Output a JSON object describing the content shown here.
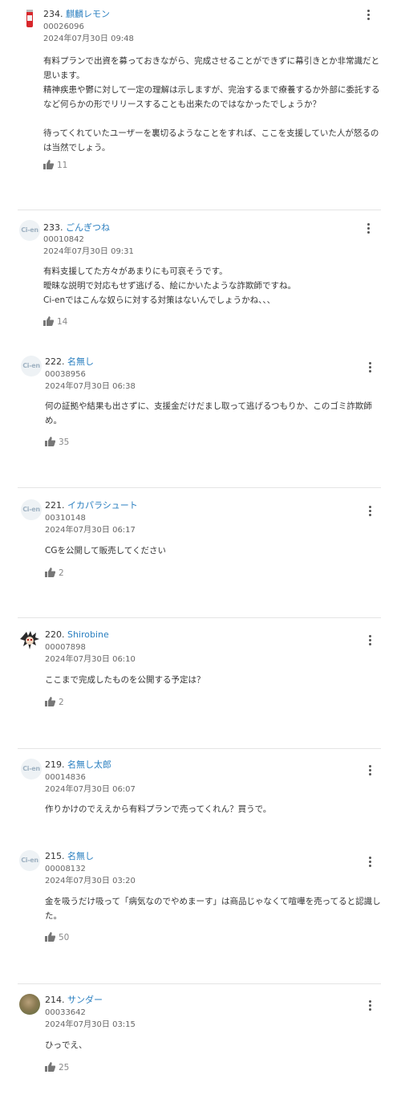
{
  "comments": [
    {
      "num": "234.",
      "name": "麒麟レモン",
      "uid": "00026096",
      "date": "2024年07月30日 09:48",
      "avatar": "can",
      "lines": [
        "有料プランで出資を募っておきながら、完成させることができずに幕引きとか非常識だと思います。",
        "精神疾患や鬱に対して一定の理解は示しますが、完治するまで療養するか外部に委託するなど何らかの形でリリースすることも出来たのではなかったでしょうか？",
        "",
        "待ってくれていたユーザーを裏切るようなことをすれば、ここを支援していた人が怒るのは当然でしょう。"
      ],
      "likes": "11"
    },
    {
      "num": "233.",
      "name": "ごんぎつね",
      "uid": "00010842",
      "date": "2024年07月30日 09:31",
      "avatar": "cien",
      "lines": [
        "有料支援してた方々があまりにも可哀そうです。",
        "曖昧な説明で対応もせず逃げる、絵にかいたような詐欺師ですね。",
        "Ci-enではこんな奴らに対する対策はないんでしょうかね、、、"
      ],
      "likes": "14"
    },
    {
      "num": "222.",
      "name": "名無し",
      "uid": "00038956",
      "date": "2024年07月30日 06:38",
      "avatar": "cien",
      "lines": [
        "何の証拠や結果も出さずに、支援金だけだまし取って逃げるつもりか、このゴミ詐欺師め。"
      ],
      "likes": "35"
    },
    {
      "num": "221.",
      "name": "イカパラシュート",
      "uid": "00310148",
      "date": "2024年07月30日 06:17",
      "avatar": "cien",
      "lines": [
        "CGを公開して販売してください"
      ],
      "likes": "2"
    },
    {
      "num": "220.",
      "name": "Shirobine",
      "uid": "00007898",
      "date": "2024年07月30日 06:10",
      "avatar": "chara",
      "lines": [
        "ここまで完成したものを公開する予定は？"
      ],
      "likes": "2"
    },
    {
      "num": "219.",
      "name": "名無し太郎",
      "uid": "00014836",
      "date": "2024年07月30日 06:07",
      "avatar": "cien",
      "lines": [
        "作りかけのでええから有料プランで売ってくれん？買うで。"
      ],
      "likes": ""
    },
    {
      "num": "215.",
      "name": "名無し",
      "uid": "00008132",
      "date": "2024年07月30日 03:20",
      "avatar": "cien",
      "lines": [
        "金を吸うだけ吸って「病気なのでやめまーす」は商品じゃなくて喧嘩を売ってると認識した。"
      ],
      "likes": "50"
    },
    {
      "num": "214.",
      "name": "サンダー",
      "uid": "00033642",
      "date": "2024年07月30日 03:15",
      "avatar": "photo",
      "lines": [
        "ひっでえ、"
      ],
      "likes": "25"
    }
  ],
  "avatar_logo_text": "Ci-en",
  "colors": {
    "name_link": "#2a7fc0",
    "separator": "#e4e4e4",
    "meta": "#666666"
  },
  "icons": {
    "like": "thumbs-up-icon",
    "menu": "more-vertical-icon"
  }
}
